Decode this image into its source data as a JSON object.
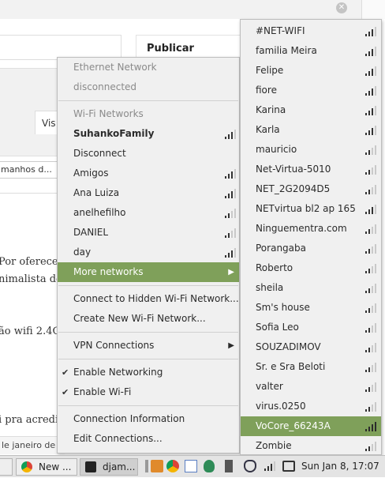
{
  "background": {
    "publish_heading": "Publicar",
    "visual_tab": "Vis",
    "format_select": "manhos d...",
    "body_lines": [
      "Por oferecer",
      "nimalista de",
      "ão wifi 2.4G",
      "i pra acredit"
    ],
    "footer_text": "le janeiro de 2"
  },
  "menu": {
    "ethernet_header": "Ethernet Network",
    "ethernet_status": "disconnected",
    "wifi_header": "Wi-Fi Networks",
    "connected_network": "SuhankoFamily",
    "disconnect": "Disconnect",
    "networks": [
      {
        "name": "Amigos",
        "bars": 3
      },
      {
        "name": "Ana Luiza",
        "bars": 3
      },
      {
        "name": "anelhefilho",
        "bars": 2
      },
      {
        "name": "DANIEL",
        "bars": 2
      },
      {
        "name": "day",
        "bars": 3
      }
    ],
    "connected_bars": 3,
    "more_networks": "More networks",
    "connect_hidden": "Connect to Hidden Wi-Fi Network...",
    "create_new": "Create New Wi-Fi Network...",
    "vpn": "VPN Connections",
    "enable_networking": "Enable Networking",
    "enable_wifi": "Enable Wi-Fi",
    "connection_info": "Connection Information",
    "edit_connections": "Edit Connections..."
  },
  "submenu": {
    "networks": [
      {
        "name": "#NET-WIFI",
        "bars": 3
      },
      {
        "name": "familia Meira",
        "bars": 3
      },
      {
        "name": "Felipe",
        "bars": 3
      },
      {
        "name": "fiore",
        "bars": 3
      },
      {
        "name": "Karina",
        "bars": 3
      },
      {
        "name": "Karla",
        "bars": 3
      },
      {
        "name": "mauricio",
        "bars": 2
      },
      {
        "name": "Net-Virtua-5010",
        "bars": 2
      },
      {
        "name": "NET_2G2094D5",
        "bars": 2
      },
      {
        "name": "NETvirtua bl2 ap 165",
        "bars": 3
      },
      {
        "name": "Ninguementra.com",
        "bars": 2
      },
      {
        "name": "Porangaba",
        "bars": 2
      },
      {
        "name": "Roberto",
        "bars": 2
      },
      {
        "name": "sheila",
        "bars": 2
      },
      {
        "name": "Sm's house",
        "bars": 2
      },
      {
        "name": "Sofia Leo",
        "bars": 2
      },
      {
        "name": "SOUZADIMOV",
        "bars": 2
      },
      {
        "name": "Sr. e Sra Beloti",
        "bars": 2
      },
      {
        "name": "valter",
        "bars": 2
      },
      {
        "name": "virus.0250",
        "bars": 2
      },
      {
        "name": "VoCore_66243A",
        "bars": 4
      },
      {
        "name": "Zombie",
        "bars": 2
      }
    ],
    "highlighted_index": 20
  },
  "taskbar": {
    "item1_label": "New ...",
    "item2_label": "djam...",
    "clock": "Sun Jan  8, 17:07"
  },
  "colors": {
    "highlight": "#7fa05a",
    "menu_bg": "#f0f0f0"
  }
}
